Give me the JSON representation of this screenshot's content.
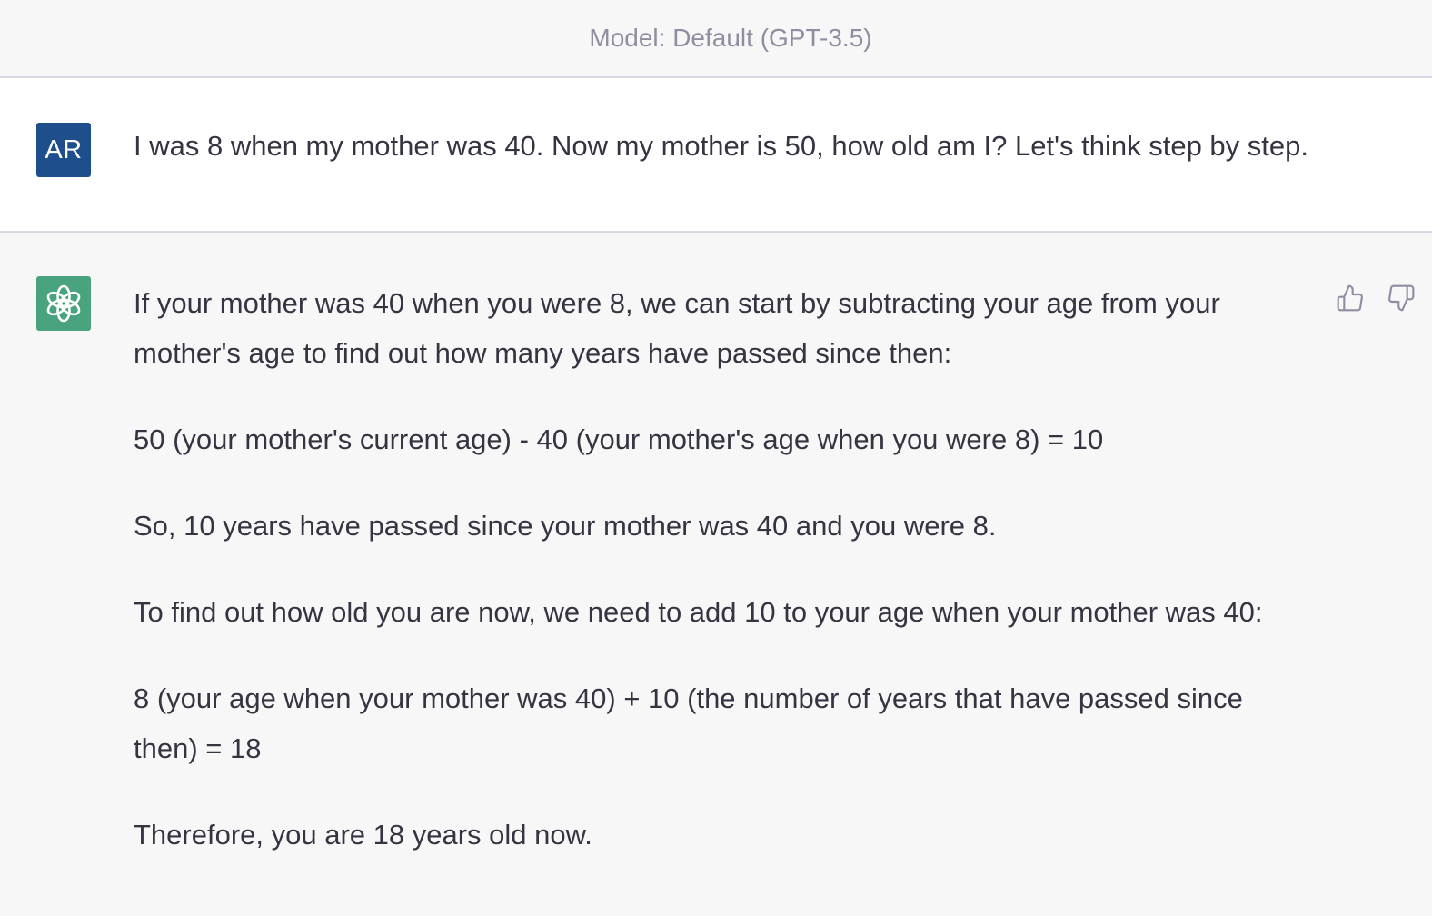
{
  "header": {
    "model_label": "Model: Default (GPT-3.5)"
  },
  "user_message": {
    "avatar_initials": "AR",
    "avatar_color": "#1f4e8c",
    "text": "I was 8 when my mother was 40. Now my mother is 50, how old am I? Let's think step by step."
  },
  "assistant_message": {
    "avatar_icon": "openai-logo-icon",
    "avatar_color": "#4aa37f",
    "paragraphs": [
      "If your mother was 40 when you were 8, we can start by subtracting your age from your mother's age to find out how many years have passed since then:",
      "50 (your mother's current age) - 40 (your mother's age when you were 8) = 10",
      "So, 10 years have passed since your mother was 40 and you were 8.",
      "To find out how old you are now, we need to add 10 to your age when your mother was 40:",
      "8 (your age when your mother was 40) + 10 (the number of years that have passed since then) = 18",
      "Therefore, you are 18 years old now."
    ],
    "feedback_icons": [
      "thumbs-up-icon",
      "thumbs-down-icon"
    ]
  }
}
